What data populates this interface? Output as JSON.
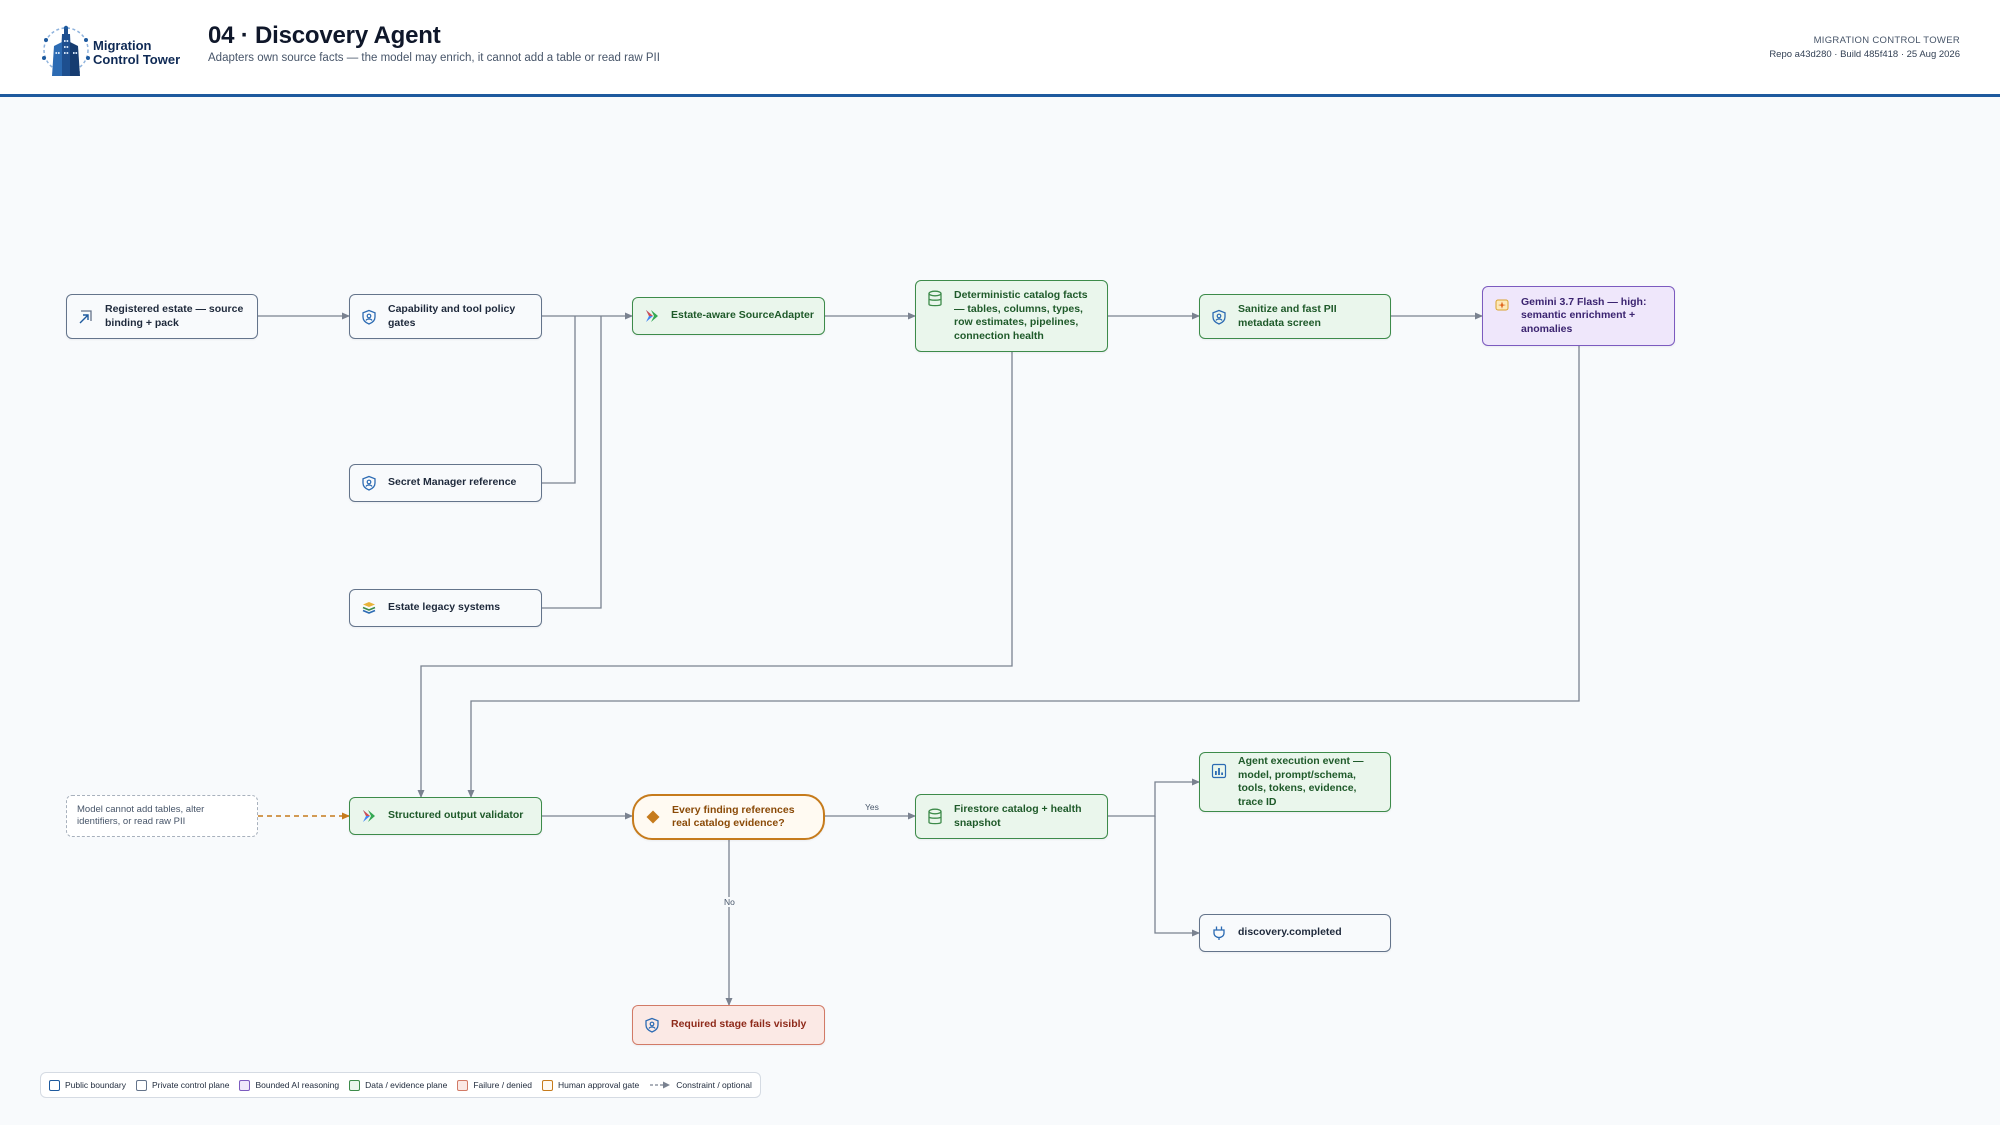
{
  "header": {
    "logo_line1": "Migration",
    "logo_line2": "Control Tower",
    "title": "04 · Discovery Agent",
    "subtitle": "Adapters own source facts — the model may enrich, it cannot add a table or read raw PII",
    "brand": "MIGRATION CONTROL TOWER",
    "build": "Repo a43d280 · Build 485f418 · 25 Aug 2026"
  },
  "colors": {
    "public": "#1e5a9e",
    "private": "#64748b",
    "ai": "#7c5bbf",
    "data": "#3d8b4a",
    "failure": "#d27a66",
    "approval": "#c67b1c",
    "connector": "#7a8290",
    "constraint": "#c67b1c"
  },
  "nodes": {
    "registered_estate": {
      "label": "Registered estate — source binding + pack",
      "icon": "arrow-up-left-icon"
    },
    "capability_gates": {
      "label": "Capability and tool policy gates",
      "icon": "shield-icon"
    },
    "secret_manager": {
      "label": "Secret Manager reference",
      "icon": "shield-icon"
    },
    "legacy_systems": {
      "label": "Estate legacy systems",
      "icon": "layers-icon"
    },
    "source_adapter": {
      "label": "Estate-aware SourceAdapter",
      "icon": "cloud-run-icon"
    },
    "catalog_facts": {
      "label": "Deterministic catalog facts — tables, columns, types, row estimates, pipelines, connection health",
      "icon": "database-icon"
    },
    "pii_screen": {
      "label": "Sanitize and fast PII metadata screen",
      "icon": "shield-icon"
    },
    "gemini": {
      "label": "Gemini 3.7 Flash — high: semantic enrichment + anomalies",
      "icon": "ai-spark-icon"
    },
    "constraint_note": {
      "label": "Model cannot add tables, alter identifiers, or read raw PII"
    },
    "validator": {
      "label": "Structured output validator",
      "icon": "cloud-run-icon"
    },
    "decision": {
      "label": "Every finding references real catalog evidence?",
      "icon": "diamond-icon"
    },
    "firestore": {
      "label": "Firestore catalog + health snapshot",
      "icon": "database-icon"
    },
    "execution_event": {
      "label": "Agent execution event — model, prompt/schema, tools, tokens, evidence, trace ID",
      "icon": "chart-icon"
    },
    "discovery_completed": {
      "label": "discovery.completed",
      "icon": "plug-icon"
    },
    "stage_fails": {
      "label": "Required stage fails visibly",
      "icon": "shield-icon"
    }
  },
  "edges": {
    "yes_label": "Yes",
    "no_label": "No"
  },
  "legend": {
    "public": "Public boundary",
    "private": "Private control plane",
    "ai": "Bounded AI reasoning",
    "data": "Data / evidence plane",
    "failure": "Failure / denied",
    "approval": "Human approval gate",
    "constraint": "Constraint / optional"
  }
}
